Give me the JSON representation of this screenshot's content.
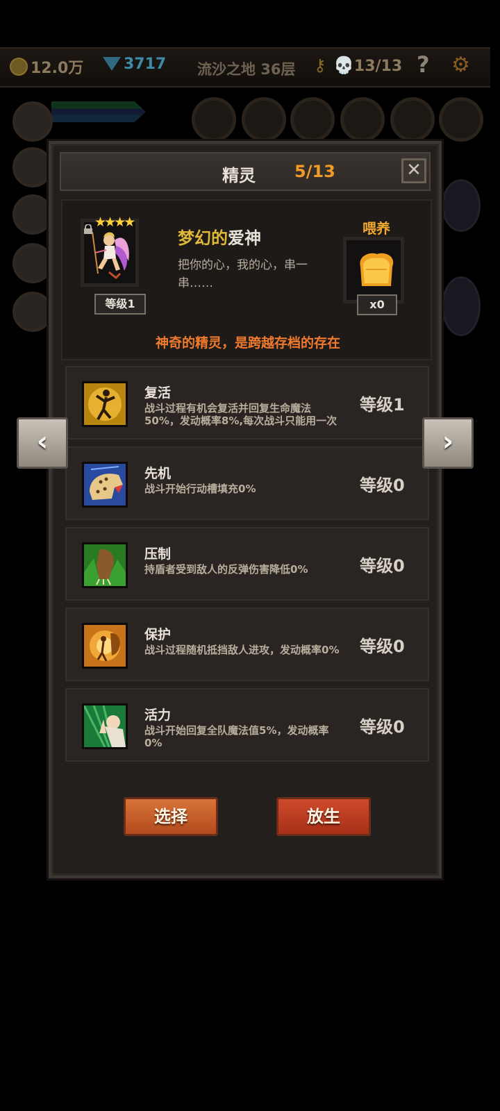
{
  "topbar": {
    "gold": "12.0万",
    "gems": "3717",
    "floor": "流沙之地 36层",
    "key_glyph": "⚷",
    "skull_glyph": "💀",
    "kills": "13/13",
    "help": "?",
    "settings_glyph": "⚙"
  },
  "modal": {
    "title": "精灵",
    "count": "5/13",
    "close": "✕"
  },
  "spirit": {
    "stars": "★★★★",
    "level": "等级1",
    "name_part1": "梦幻的",
    "name_part2": "爱神",
    "description": "把你的心，我的心，串一串……",
    "feed_label": "喂养",
    "feed_count": "x0",
    "note": "神奇的精灵，是跨越存档的存在"
  },
  "skills": [
    {
      "name": "复活",
      "desc": "战斗过程有机会复活并回复生命魔法50%，发动概率8%,每次战斗只能用一次",
      "level": "等级1",
      "icon": "revive-icon"
    },
    {
      "name": "先机",
      "desc": "战斗开始行动槽填充0%",
      "level": "等级0",
      "icon": "leopard-icon"
    },
    {
      "name": "压制",
      "desc": "持盾者受到敌人的反弹伤害降低0%",
      "level": "等级0",
      "icon": "claw-icon"
    },
    {
      "name": "保护",
      "desc": "战斗过程随机抵挡敌人进攻，发动概率0%",
      "level": "等级0",
      "icon": "fairy-icon"
    },
    {
      "name": "活力",
      "desc": "战斗开始回复全队魔法值5%，发动概率0%",
      "level": "等级0",
      "icon": "prayer-icon"
    }
  ],
  "buttons": {
    "select": "选择",
    "release": "放生"
  },
  "nav": {
    "prev": "‹",
    "next": "›"
  },
  "colors": {
    "accent_orange": "#f09a28",
    "note_orange": "#f07a2e",
    "name_gold": "#e0b838",
    "star_yellow": "#ffd23a"
  }
}
